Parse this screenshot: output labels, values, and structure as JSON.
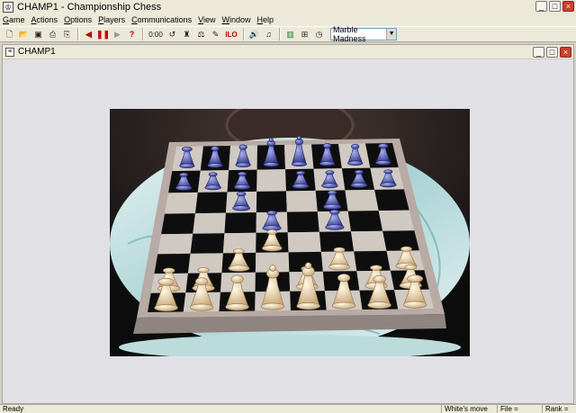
{
  "window": {
    "title": "CHAMP1 - Championship Chess",
    "icon": "chess-app-icon",
    "controls": {
      "minimize": "_",
      "maximize": "□",
      "close": "×"
    }
  },
  "menu": [
    {
      "label": "Game",
      "accel": "G"
    },
    {
      "label": "Actions",
      "accel": "A"
    },
    {
      "label": "Options",
      "accel": "O"
    },
    {
      "label": "Players",
      "accel": "P"
    },
    {
      "label": "Communications",
      "accel": "C"
    },
    {
      "label": "View",
      "accel": "V"
    },
    {
      "label": "Window",
      "accel": "W"
    },
    {
      "label": "Help",
      "accel": "H"
    }
  ],
  "toolbar": {
    "clock_label": "0:00",
    "theme_value": "Marble Madness",
    "icons": [
      "new-icon",
      "open-icon",
      "save-icon",
      "print-icon",
      "print-preview-icon",
      "back-icon",
      "pause-icon",
      "forward-icon",
      "hint-icon",
      "clock-icon",
      "undo-icon",
      "setup-icon",
      "analysis-icon",
      "edit-icon",
      "level-icon",
      "sound-icon",
      "music-icon",
      "chart-icon",
      "board-view-icon",
      "timer-icon"
    ],
    "level_label": "ILO"
  },
  "child": {
    "title": "CHAMP1"
  },
  "status": {
    "ready": "Ready",
    "move": "White's move",
    "file": "File =",
    "rank": "Rank ="
  },
  "board": {
    "light_color": "#cfc9c2",
    "dark_color": "#0e0e0e",
    "frame_color": "#b8aaa4",
    "white_piece_color": "#f1dfba",
    "black_piece_color": "#5a5fb0",
    "table_color": "#cfe4e4"
  }
}
